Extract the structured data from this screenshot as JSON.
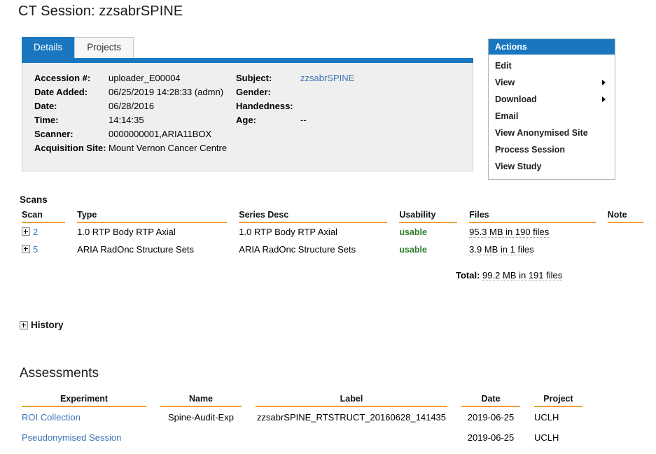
{
  "page": {
    "title": "CT Session: zzsabrSPINE"
  },
  "tabs": [
    {
      "label": "Details",
      "active": true
    },
    {
      "label": "Projects",
      "active": false
    }
  ],
  "details": {
    "left": [
      {
        "label": "Accession #:",
        "value": "uploader_E00004",
        "link": false
      },
      {
        "label": "Date Added:",
        "value": "06/25/2019 14:28:33 (admn)",
        "link": false
      },
      {
        "label": "Date:",
        "value": "06/28/2016",
        "link": false
      },
      {
        "label": "Time:",
        "value": "14:14:35",
        "link": false
      },
      {
        "label": "Scanner:",
        "value": "0000000001,ARIA11BOX",
        "link": false
      },
      {
        "label": "Acquisition Site:",
        "value": "Mount Vernon Cancer Centre",
        "link": false
      }
    ],
    "right": [
      {
        "label": "Subject:",
        "value": "zzsabrSPINE",
        "link": true
      },
      {
        "label": "Gender:",
        "value": "",
        "link": false
      },
      {
        "label": "Handedness:",
        "value": "",
        "link": false
      },
      {
        "label": "Age:",
        "value": "--",
        "link": false
      }
    ]
  },
  "actions": {
    "header": "Actions",
    "items": [
      {
        "label": "Edit",
        "submenu": false
      },
      {
        "label": "View",
        "submenu": true
      },
      {
        "label": "Download",
        "submenu": true
      },
      {
        "label": "Email",
        "submenu": false
      },
      {
        "label": "View Anonymised Site",
        "submenu": false
      },
      {
        "label": "Process Session",
        "submenu": false
      },
      {
        "label": "View Study",
        "submenu": false
      }
    ]
  },
  "scans": {
    "heading": "Scans",
    "columns": [
      "Scan",
      "Type",
      "Series Desc",
      "Usability",
      "Files",
      "Note"
    ],
    "rows": [
      {
        "scan": "2",
        "type": "1.0 RTP Body RTP Axial",
        "series_desc": "1.0 RTP Body RTP Axial",
        "usability": "usable",
        "files": "95.3 MB in 190 files",
        "note": ""
      },
      {
        "scan": "5",
        "type": "ARIA RadOnc Structure Sets",
        "series_desc": "ARIA RadOnc Structure Sets",
        "usability": "usable",
        "files": "3.9 MB in 1 files",
        "note": ""
      }
    ],
    "total_label": "Total:",
    "total_value": "99.2 MB in 191 files"
  },
  "history": {
    "label": "History"
  },
  "assessments": {
    "heading": "Assessments",
    "columns": [
      "Experiment",
      "Name",
      "Label",
      "Date",
      "Project"
    ],
    "rows": [
      {
        "experiment": "ROI Collection",
        "name": "Spine-Audit-Exp",
        "label": "zzsabrSPINE_RTSTRUCT_20160628_141435",
        "date": "2019-06-25",
        "project": "UCLH"
      },
      {
        "experiment": "Pseudonymised Session",
        "name": "",
        "label": "",
        "date": "2019-06-25",
        "project": "UCLH"
      }
    ]
  },
  "colors": {
    "accent_blue": "#1a77bf",
    "rule_orange": "#f29c38",
    "link_blue": "#3a74b5",
    "usable_green": "#2d7d2d",
    "panel_gray": "#efefef"
  }
}
